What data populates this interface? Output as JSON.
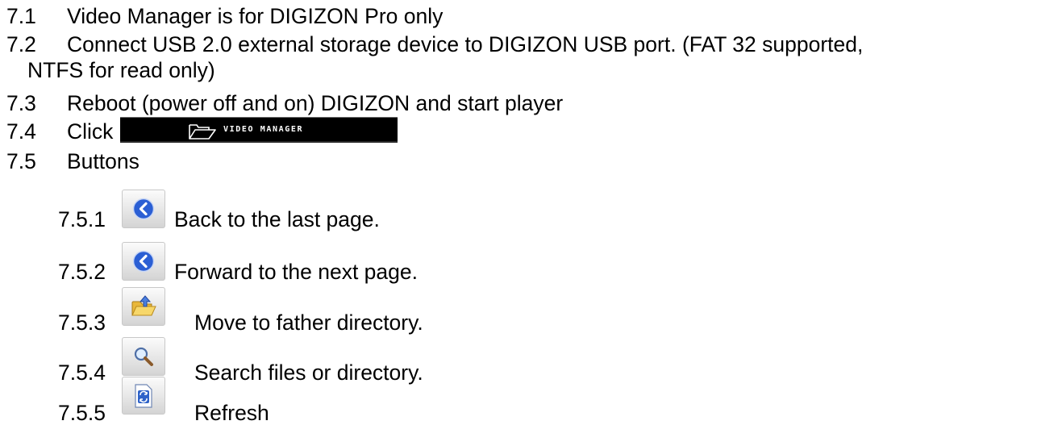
{
  "items": [
    {
      "num": "7.1",
      "text": "Video Manager is for DIGIZON Pro only"
    },
    {
      "num": "7.2",
      "text": "Connect USB 2.0 external storage device to DIGIZON USB port. (FAT 32 supported,",
      "continuation": "NTFS for read only)"
    },
    {
      "num": "7.3",
      "text": "Reboot (power off and on) DIGIZON and start player"
    },
    {
      "num": "7.4",
      "text": "Click"
    },
    {
      "num": "7.5",
      "text": "Buttons"
    }
  ],
  "video_manager_button": {
    "label": "VIDEO MANAGER",
    "icon": "folder-icon"
  },
  "buttons": [
    {
      "num": "7.5.1",
      "text": "Back to the last page.",
      "icon": "back-arrow-icon"
    },
    {
      "num": "7.5.2",
      "text": "Forward to the next page.",
      "icon": "forward-arrow-icon"
    },
    {
      "num": "7.5.3",
      "text": "Move to father directory.",
      "icon": "folder-up-icon"
    },
    {
      "num": "7.5.4",
      "text": "Search files or directory.",
      "icon": "magnifier-icon"
    },
    {
      "num": "7.5.5",
      "text": "Refresh",
      "icon": "refresh-icon"
    }
  ],
  "colors": {
    "text": "#000000",
    "arrow_blue": "#2b5fd4",
    "folder_yellow": "#f2c443",
    "button_black": "#000000"
  }
}
